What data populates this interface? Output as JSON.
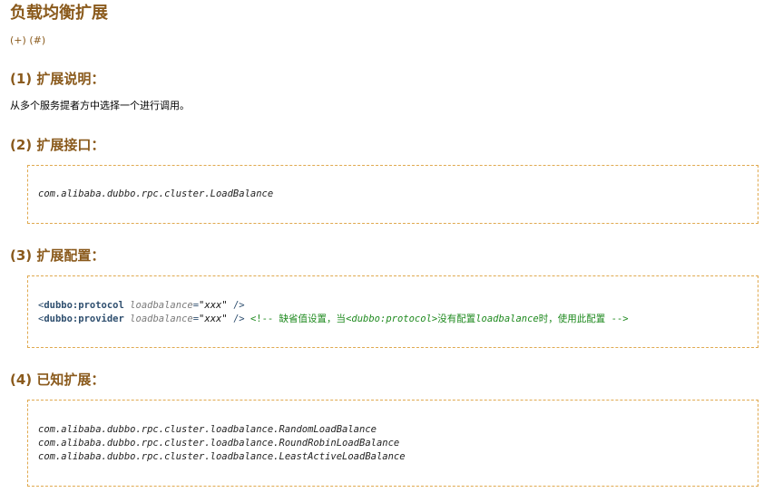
{
  "page": {
    "title": "负载均衡扩展",
    "links": {
      "plus": "(+)",
      "hash": "(#)"
    }
  },
  "sections": {
    "description": {
      "heading": "(1) 扩展说明：",
      "text": "从多个服务提者方中选择一个进行调用。"
    },
    "interface": {
      "heading": "(2) 扩展接口：",
      "code": "com.alibaba.dubbo.rpc.cluster.LoadBalance"
    },
    "config": {
      "heading": "(3) 扩展配置：",
      "line1": {
        "open": "<",
        "tag": "dubbo:protocol",
        "attr": "loadbalance",
        "eq": "=",
        "value": "\"xxx\"",
        "close": " />"
      },
      "line2": {
        "open": "<",
        "tag": "dubbo:provider",
        "attr": "loadbalance",
        "eq": "=",
        "value": "\"xxx\"",
        "close": " />",
        "comment_start": "<!-- 缺省值设置，当",
        "comment_tag": "<dubbo:protocol>",
        "comment_mid": "没有配置",
        "comment_attr": "loadbalance",
        "comment_end": "时，使用此配置 -->"
      }
    },
    "known": {
      "heading": "(4) 已知扩展：",
      "items": [
        "com.alibaba.dubbo.rpc.cluster.loadbalance.RandomLoadBalance",
        "com.alibaba.dubbo.rpc.cluster.loadbalance.RoundRobinLoadBalance",
        "com.alibaba.dubbo.rpc.cluster.loadbalance.LeastActiveLoadBalance"
      ]
    }
  },
  "colors": {
    "heading": "#8a5a1c",
    "box_border": "#e0a94f",
    "tag": "#2f4f6f",
    "attribute": "#7a7a7a",
    "comment": "#1f8a1f"
  }
}
